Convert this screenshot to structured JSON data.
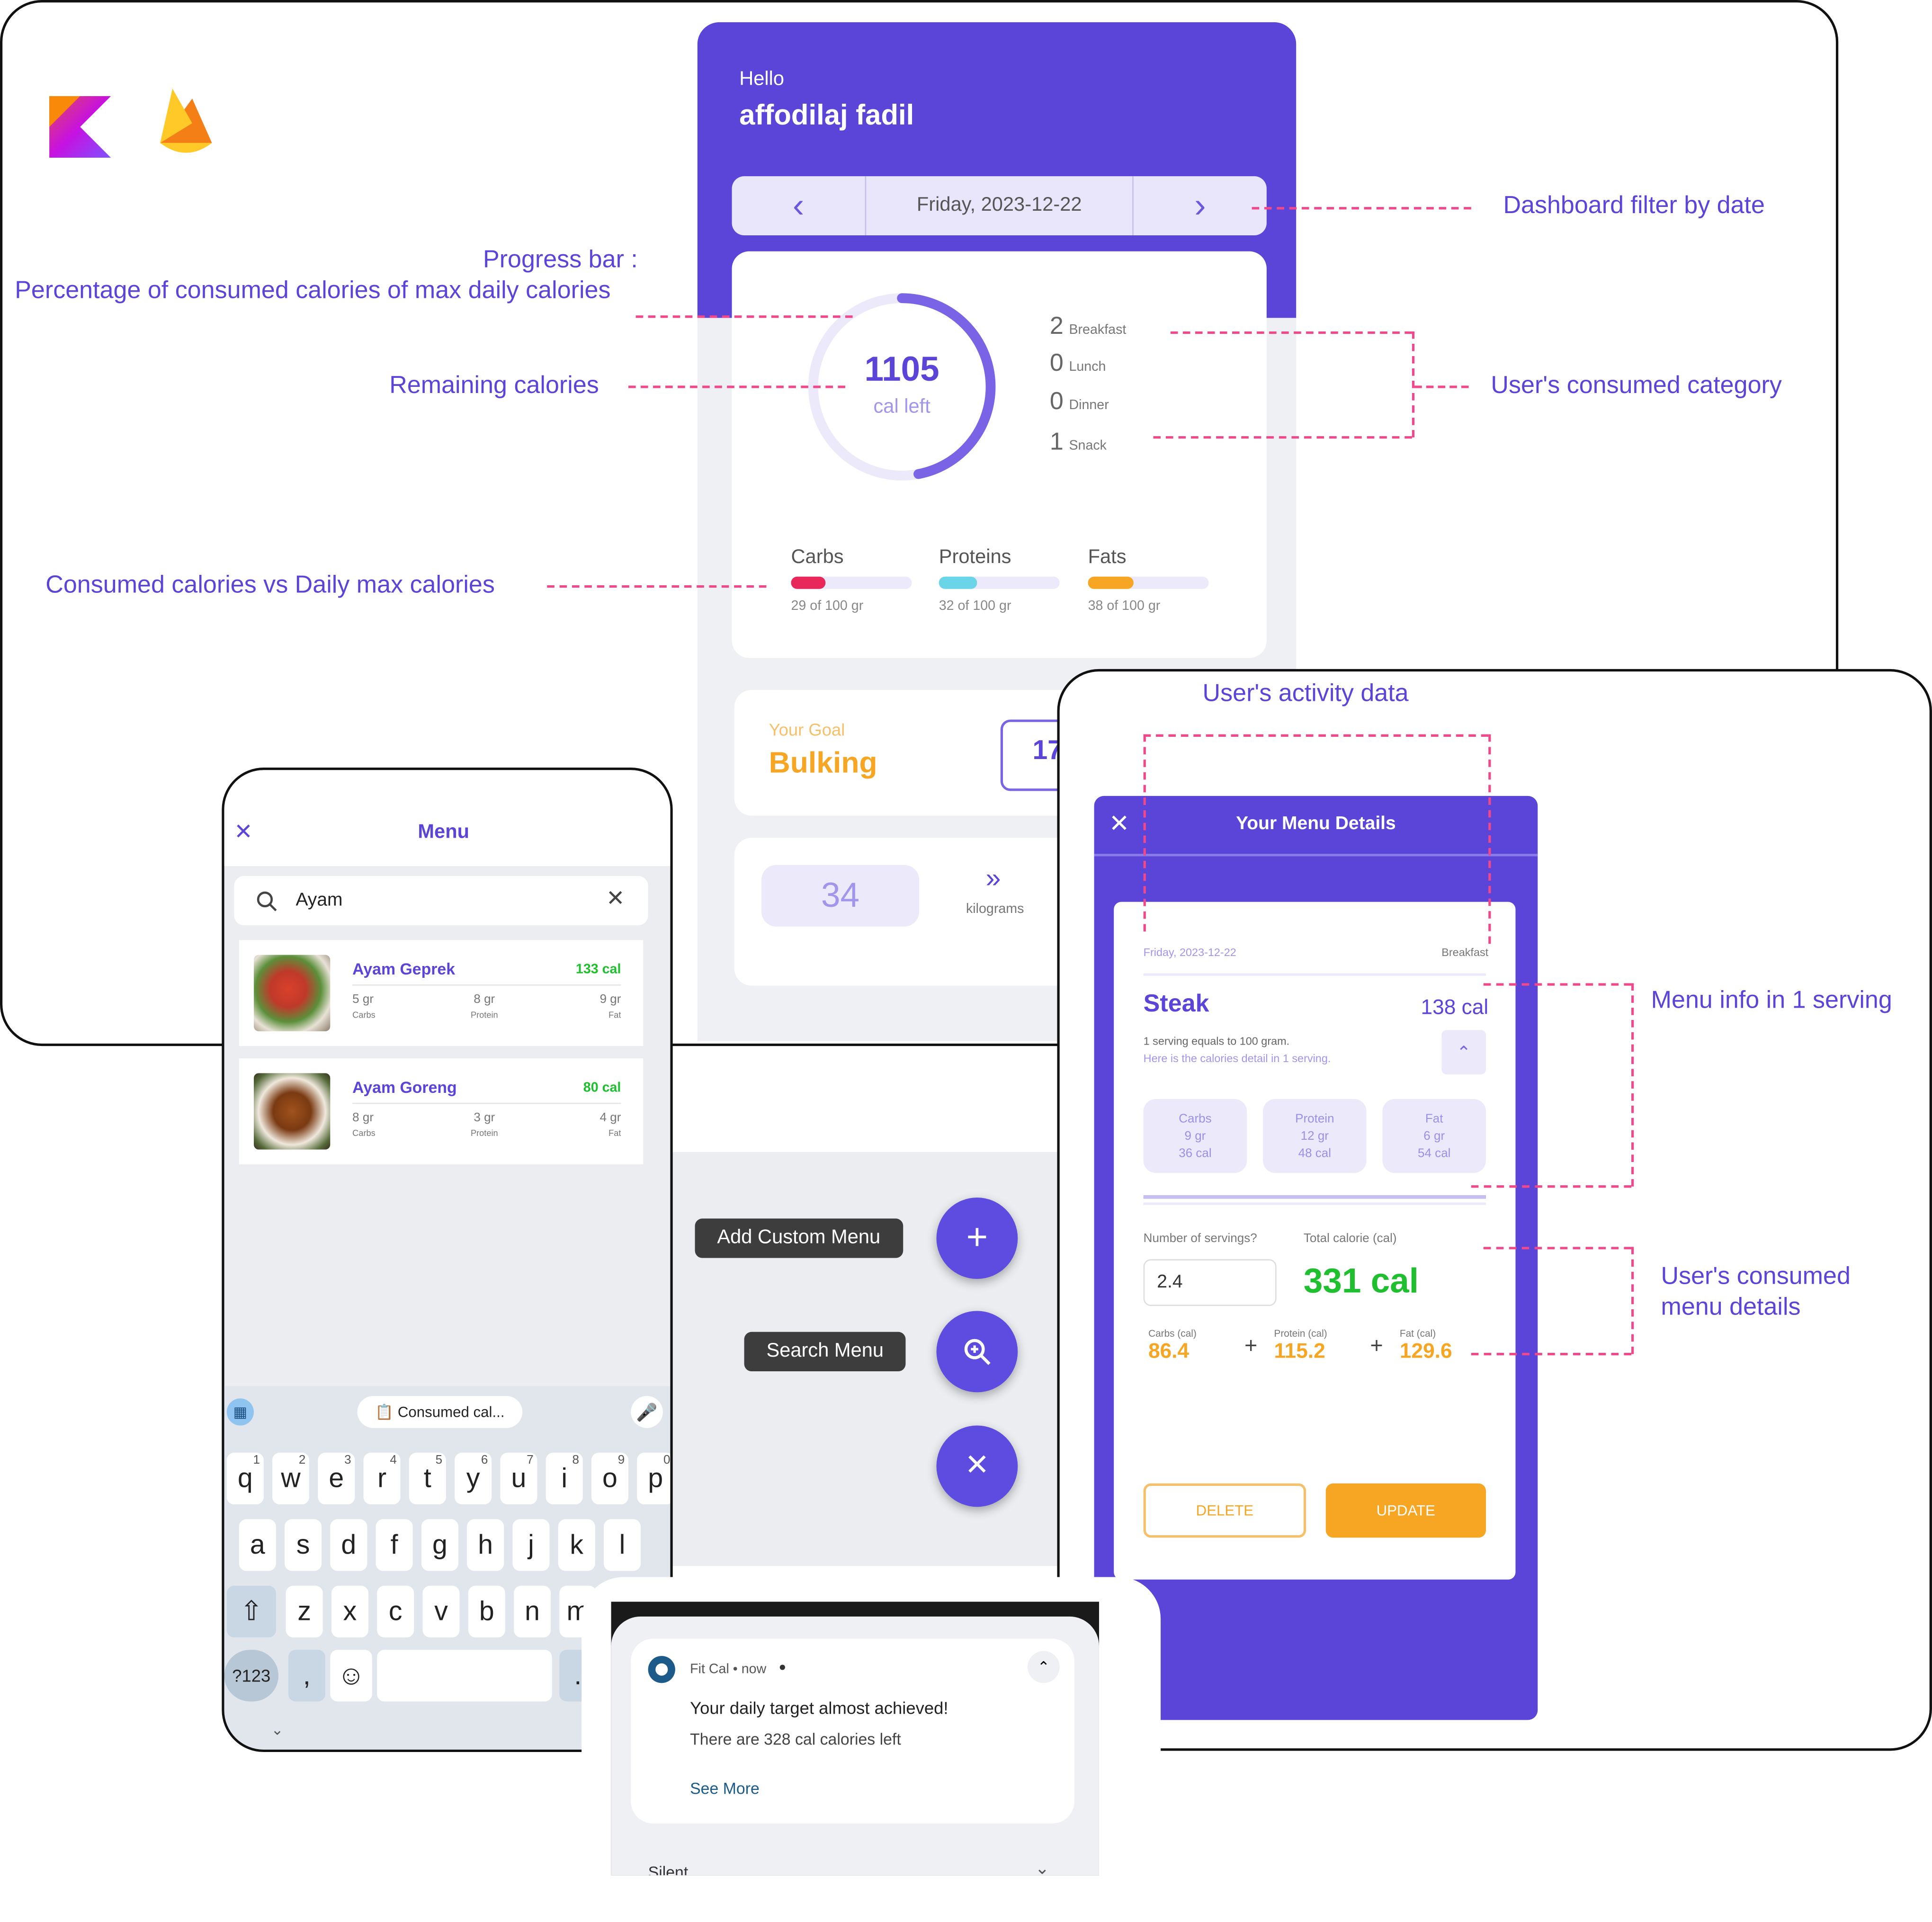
{
  "colors": {
    "brand": "#5b45d9",
    "accent_orange": "#f6a623",
    "carbs": "#e8285a",
    "proteins": "#6ad5e8",
    "fats": "#f6a623",
    "success": "#1fbf2f",
    "annotation_line": "#f0488a"
  },
  "logos": {
    "kotlin": "kotlin-icon",
    "firebase": "firebase-icon"
  },
  "annotations": {
    "dashboard_filter": "Dashboard filter by date",
    "progress_bar_title": "Progress bar :",
    "progress_bar_desc": "Percentage of consumed calories of max daily calories",
    "remaining": "Remaining calories",
    "consumed_category": "User's consumed category",
    "consumed_vs_max": "Consumed calories vs Daily max calories",
    "activity": "User's activity data",
    "menu_info": "Menu info in 1 serving",
    "consumed_menu_line1": "User's consumed",
    "consumed_menu_line2": "menu details"
  },
  "dashboard": {
    "greeting": "Hello",
    "user_name": "affodilaj fadil",
    "date": "Friday, 2023-12-22",
    "calories_left": "1105",
    "calories_left_label": "cal left",
    "calorie_progress": 0.47,
    "categories": [
      {
        "count": "2",
        "label": "Breakfast"
      },
      {
        "count": "0",
        "label": "Lunch"
      },
      {
        "count": "0",
        "label": "Dinner"
      },
      {
        "count": "1",
        "label": "Snack"
      }
    ],
    "macros": [
      {
        "name": "Carbs",
        "detail": "29 of 100 gr",
        "value": 29
      },
      {
        "name": "Proteins",
        "detail": "32 of 100 gr",
        "value": 32
      },
      {
        "name": "Fats",
        "detail": "38 of 100 gr",
        "value": 38
      }
    ],
    "goal_label": "Your Goal",
    "goal_value": "Bulking",
    "goal_partial_number": "17",
    "weight_value": "34",
    "weight_unit": "kilograms"
  },
  "menu_screen": {
    "title": "Menu",
    "search_value": "Ayam",
    "items": [
      {
        "name": "Ayam Geprek",
        "cal": "133 cal",
        "carbs": "5 gr",
        "protein": "8 gr",
        "fat": "9 gr"
      },
      {
        "name": "Ayam Goreng",
        "cal": "80 cal",
        "carbs": "8 gr",
        "protein": "3 gr",
        "fat": "4 gr"
      }
    ],
    "labels": {
      "carbs": "Carbs",
      "protein": "Protein",
      "fat": "Fat"
    },
    "clipboard_chip": "Consumed cal...",
    "keyboard": {
      "row1": [
        "q",
        "w",
        "e",
        "r",
        "t",
        "y",
        "u",
        "i",
        "o",
        "p"
      ],
      "row1_hints": [
        "1",
        "2",
        "3",
        "4",
        "5",
        "6",
        "7",
        "8",
        "9",
        "0"
      ],
      "row2": [
        "a",
        "s",
        "d",
        "f",
        "g",
        "h",
        "j",
        "k",
        "l"
      ],
      "row3": [
        "z",
        "x",
        "c",
        "v",
        "b",
        "n",
        "m"
      ],
      "symbols": "?123",
      "comma": ",",
      "period": "."
    }
  },
  "fab_menu": {
    "add_custom": "Add Custom Menu",
    "search": "Search Menu"
  },
  "menu_details": {
    "title": "Your Menu Details",
    "date": "Friday, 2023-12-22",
    "meal": "Breakfast",
    "food": "Steak",
    "cal": "138 cal",
    "serving_note": "1 serving equals to 100 gram.",
    "serving_note2": "Here is the calories detail in 1 serving.",
    "nutrients": [
      {
        "name": "Carbs",
        "gr": "9 gr",
        "cal": "36 cal"
      },
      {
        "name": "Protein",
        "gr": "12 gr",
        "cal": "48 cal"
      },
      {
        "name": "Fat",
        "gr": "6 gr",
        "cal": "54 cal"
      }
    ],
    "servings_label": "Number of servings?",
    "servings_value": "2.4",
    "total_label": "Total calorie (cal)",
    "total_value": "331 cal",
    "breakdown": [
      {
        "label": "Carbs (cal)",
        "value": "86.4"
      },
      {
        "label": "Protein (cal)",
        "value": "115.2"
      },
      {
        "label": "Fat (cal)",
        "value": "129.6"
      }
    ],
    "plus": "+",
    "delete": "DELETE",
    "update": "UPDATE"
  },
  "notification": {
    "app": "Fit Cal • now",
    "title": "Your daily target almost achieved!",
    "body": "There are 328 cal calories left",
    "action": "See More",
    "section": "Silent"
  }
}
